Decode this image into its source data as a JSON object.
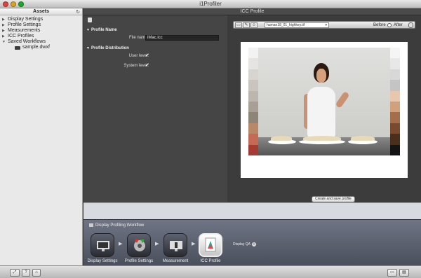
{
  "window": {
    "title": "i1Profiler"
  },
  "sidebar": {
    "header": "Assets",
    "items": [
      {
        "label": "Display Settings"
      },
      {
        "label": "Profile Settings"
      },
      {
        "label": "Measurements"
      },
      {
        "label": "ICC Profiles"
      },
      {
        "label": "Saved Workflows"
      }
    ],
    "saved_file": "sample.dwxf"
  },
  "main": {
    "title": "ICC Profile",
    "profile_name_section": "Profile Name",
    "file_name_label": "File name:",
    "file_name_value": "iMac.icc",
    "distribution_section": "Profile Distribution",
    "user_level_label": "User level:",
    "system_level_label": "System level:",
    "user_level_checked": true,
    "system_level_checked": true
  },
  "preview": {
    "image_name": "human18_01_highkey.tif",
    "before_label": "Before",
    "after_label": "After",
    "create_button": "Create and save profile"
  },
  "workflow": {
    "title": "Display Profiling Workflow",
    "steps": [
      {
        "label": "Display Settings",
        "icon": "display-settings-icon"
      },
      {
        "label": "Profile Settings",
        "icon": "profile-settings-icon"
      },
      {
        "label": "Measurement",
        "icon": "measurement-icon"
      },
      {
        "label": "ICC Profile",
        "icon": "icc-profile-icon",
        "active": true
      }
    ],
    "qa_label": "Display QA"
  },
  "colors": {
    "swatches_left": [
      "#f2f2f2",
      "#e6e4e2",
      "#d8d4d0",
      "#cac4be",
      "#bdb6ae",
      "#a99f95",
      "#8f8478",
      "#b98868",
      "#c76a55",
      "#a83a34"
    ],
    "swatches_right": [
      "#f5f5f5",
      "#e8e8e8",
      "#d8d8d8",
      "#c4c4c4",
      "#e8c7ae",
      "#d1a07c",
      "#a56d49",
      "#7a4a2e",
      "#4a2e1e",
      "#141414"
    ]
  }
}
